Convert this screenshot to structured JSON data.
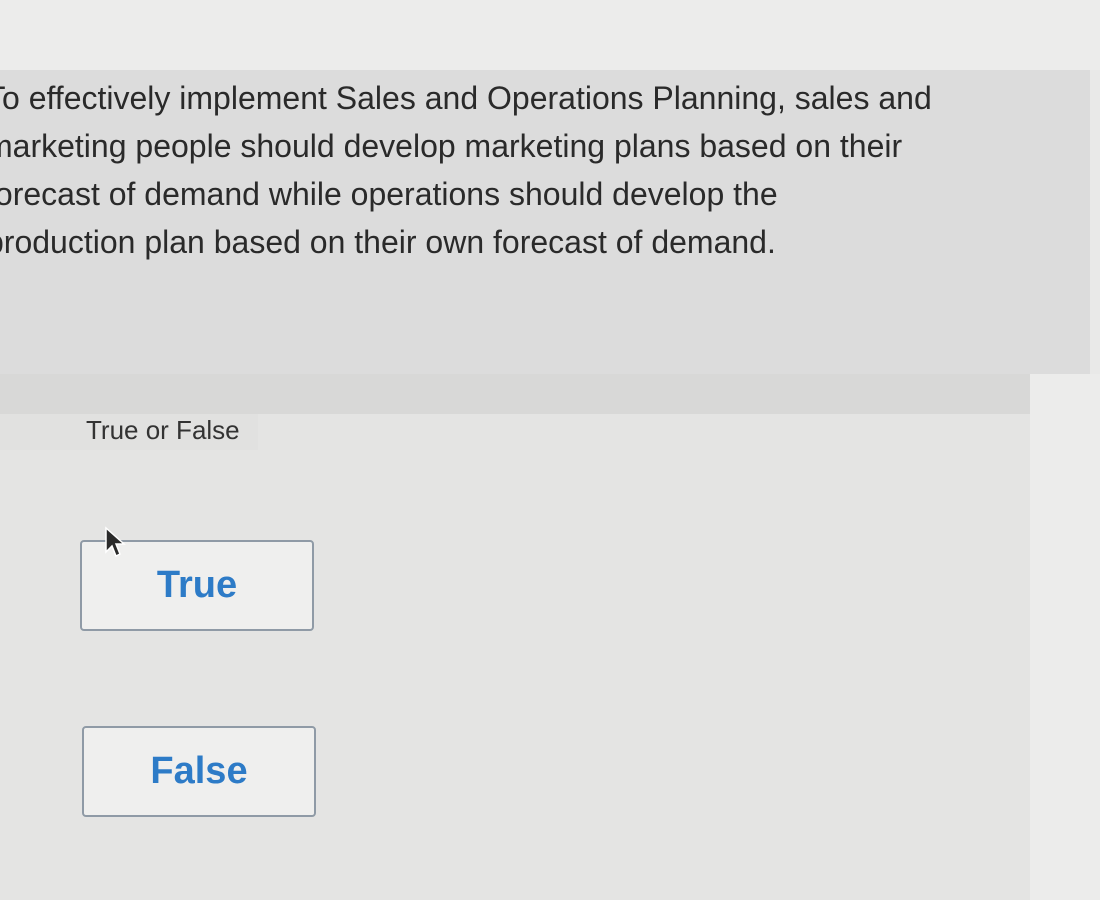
{
  "question": {
    "lines": [
      "To effectively implement Sales and Operations Planning, sales and",
      "marketing people should develop marketing plans based on their",
      "forecast of demand while operations should develop the",
      "production plan based on their own forecast of demand."
    ]
  },
  "question_type": "True or False",
  "choices": [
    {
      "label": "True"
    },
    {
      "label": "False"
    }
  ],
  "colors": {
    "choice_text": "#2d7bc7",
    "choice_border": "#8f9aa6",
    "question_bg": "#dcdcdc"
  },
  "icons": {
    "cursor": "mouse-pointer-icon"
  }
}
